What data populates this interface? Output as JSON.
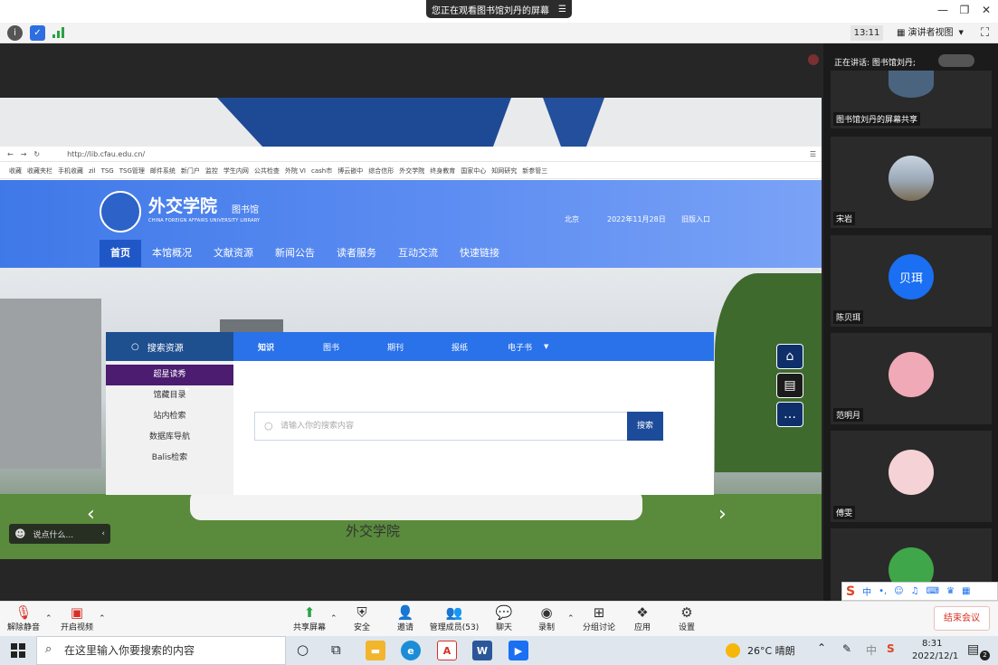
{
  "window": {
    "share_banner": "您正在观看图书馆刘丹的屏幕",
    "menu_icon": "hamburger-icon",
    "minimize_icon": "minimize-icon",
    "restore_icon": "restore-icon",
    "close_icon": "close-icon"
  },
  "toolbar": {
    "info_icon": "info-icon",
    "shield_icon": "shield-icon",
    "signal_icon": "signal-icon",
    "time": "13:11",
    "view_mode": "演讲者视图",
    "fullscreen_icon": "fullscreen-icon"
  },
  "browser": {
    "url": "http://lib.cfau.edu.cn/",
    "bookmarks": [
      "收藏",
      "收藏夹栏",
      "手机收藏",
      "zil",
      "TSG",
      "TSG管理",
      "邮件系统",
      "新门户",
      "监控",
      "学生内网",
      "公共检查",
      "外院 VI",
      "cash市",
      "博云嵌中",
      "综合信形",
      "外交学院",
      "终身教育",
      "国家中心",
      "知网研究",
      "新参管三"
    ]
  },
  "library": {
    "logo_cn": "外交学院",
    "logo_suffix": "图书馆",
    "logo_en": "CHINA FOREIGN AFFAIRS UNIVERSITY LIBRARY",
    "city": "北京",
    "date": "2022年11月28日",
    "old_entry": "旧版入口",
    "nav": [
      "首页",
      "本馆概况",
      "文献资源",
      "新闻公告",
      "读者服务",
      "互动交流",
      "快速链接"
    ],
    "search_title": "搜索资源",
    "tabs": [
      "知识",
      "图书",
      "期刊",
      "报纸",
      "电子书"
    ],
    "menu": [
      "超星读秀",
      "馆藏目录",
      "站内检索",
      "数据库导航",
      "Balis检索"
    ],
    "search_placeholder": "请输入你的搜索内容",
    "search_button": "搜索",
    "monument_text": "外交学院"
  },
  "overlay": {
    "chat_placeholder": "说点什么..."
  },
  "participants": {
    "speaking": "正在讲话: 图书馆刘丹;",
    "tiles": [
      {
        "name": "图书馆刘丹的屏幕共享"
      },
      {
        "name": "宋岩"
      },
      {
        "name": "陈贝珥",
        "initials": "贝珥"
      },
      {
        "name": "范明月"
      },
      {
        "name": "傅雯"
      },
      {
        "name": ""
      }
    ]
  },
  "controls": {
    "items": [
      "解除静音",
      "开启视频",
      "共享屏幕",
      "安全",
      "邀请",
      "管理成员(53)",
      "聊天",
      "录制",
      "分组讨论",
      "应用",
      "设置"
    ],
    "end": "结束会议"
  },
  "ime": {
    "label": "中"
  },
  "taskbar": {
    "search_placeholder": "在这里输入你要搜索的内容",
    "weather": "26°C 晴朗",
    "time": "8:31",
    "date": "2022/12/1",
    "notification_count": "2"
  },
  "colors": {
    "brand_blue": "#2a72ea",
    "menu_active": "#4b1c6f",
    "end_red": "#d93025"
  }
}
